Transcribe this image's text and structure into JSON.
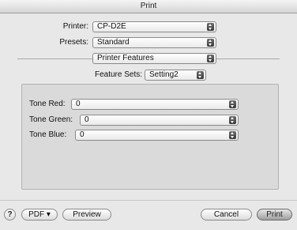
{
  "window": {
    "title": "Print"
  },
  "printer": {
    "label": "Printer:",
    "value": "CP-D2E"
  },
  "presets": {
    "label": "Presets:",
    "value": "Standard"
  },
  "pane": {
    "value": "Printer Features"
  },
  "feature_sets": {
    "label": "Feature Sets:",
    "value": "Setting2"
  },
  "tones": [
    {
      "label": "Tone Red:",
      "value": "0"
    },
    {
      "label": "Tone Green:",
      "value": "0"
    },
    {
      "label": "Tone Blue:",
      "value": "0"
    }
  ],
  "footer": {
    "help": "?",
    "pdf": "PDF ▾",
    "preview": "Preview",
    "cancel": "Cancel",
    "print": "Print"
  }
}
